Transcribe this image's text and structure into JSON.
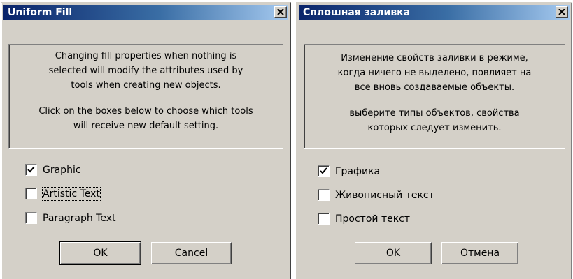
{
  "dialog_en": {
    "title": "Uniform Fill",
    "info_line1": "Changing fill properties when nothing is",
    "info_line2": "selected will modify the attributes used by",
    "info_line3": "tools when creating new objects.",
    "info_line4": "Click on the boxes below to choose which tools",
    "info_line5": "will receive new default setting.",
    "options": [
      {
        "label": "Graphic",
        "checked": true
      },
      {
        "label": "Artistic Text",
        "checked": false
      },
      {
        "label": "Paragraph Text",
        "checked": false
      }
    ],
    "ok_label": "OK",
    "cancel_label": "Cancel"
  },
  "dialog_ru": {
    "title": "Сплошная заливка",
    "info_line1": "Изменение свойств заливки в режиме,",
    "info_line2": "когда ничего не выделено, повлияет на",
    "info_line3": "все вновь создаваемые объекты.",
    "info_line4": "выберите типы объектов, свойства",
    "info_line5": "которых следует изменить.",
    "options": [
      {
        "label": "Графика",
        "checked": true
      },
      {
        "label": "Живописный текст",
        "checked": false
      },
      {
        "label": "Простой текст",
        "checked": false
      }
    ],
    "ok_label": "OK",
    "cancel_label": "Отмена"
  },
  "icons": {
    "close": "close-icon",
    "check": "checkmark-icon"
  },
  "colors": {
    "title_gradient_start": "#0a246a",
    "title_gradient_end": "#a6caf0",
    "dialog_face": "#d4d0c8"
  }
}
